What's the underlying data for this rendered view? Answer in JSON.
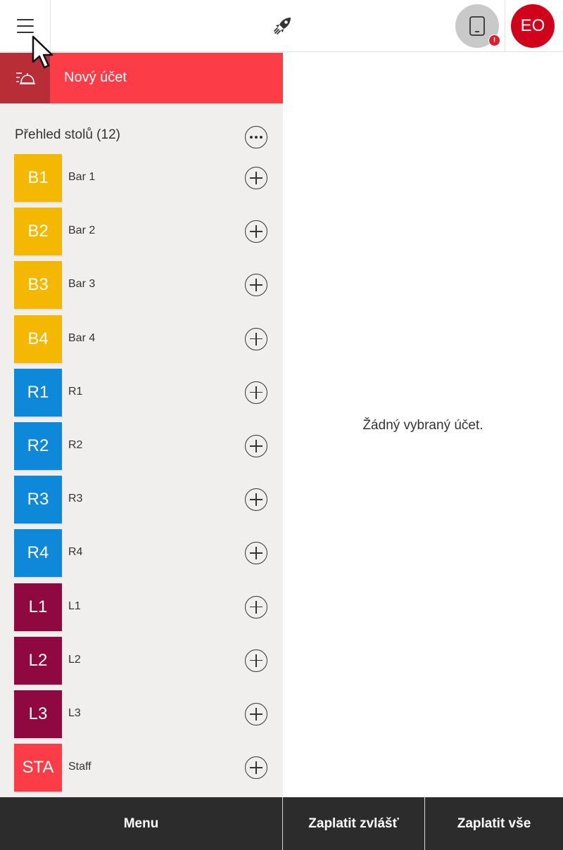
{
  "header": {
    "menu_icon": "hamburger-icon",
    "center_icon": "rocket-icon",
    "device_icon": "tablet-icon",
    "device_alert": "!",
    "avatar_initials": "EO"
  },
  "sidebar": {
    "new_bill_label": "Nový účet",
    "new_bill_icon": "service-bell-icon",
    "overview_title": "Přehled stolů (12)",
    "more_icon": "more-horizontal-icon",
    "tables": [
      {
        "code": "B1",
        "name": "Bar 1",
        "color": "#f5b800"
      },
      {
        "code": "B2",
        "name": "Bar 2",
        "color": "#f5b800"
      },
      {
        "code": "B3",
        "name": "Bar 3",
        "color": "#f5b800"
      },
      {
        "code": "B4",
        "name": "Bar 4",
        "color": "#f5b800"
      },
      {
        "code": "R1",
        "name": "R1",
        "color": "#0e88d8"
      },
      {
        "code": "R2",
        "name": "R2",
        "color": "#0e88d8"
      },
      {
        "code": "R3",
        "name": "R3",
        "color": "#0e88d8"
      },
      {
        "code": "R4",
        "name": "R4",
        "color": "#0e88d8"
      },
      {
        "code": "L1",
        "name": "L1",
        "color": "#8f0840"
      },
      {
        "code": "L2",
        "name": "L2",
        "color": "#8f0840"
      },
      {
        "code": "L3",
        "name": "L3",
        "color": "#8f0840"
      },
      {
        "code": "STA",
        "name": "Staff",
        "color": "#fc3d47"
      }
    ]
  },
  "main": {
    "empty_message": "Žádný vybraný účet."
  },
  "footer": {
    "menu_label": "Menu",
    "pay_separately_label": "Zaplatit zvlášť",
    "pay_all_label": "Zaplatit vše"
  },
  "colors": {
    "accent": "#fc3d47",
    "accent_dark": "#b82d36",
    "avatar": "#d0021b",
    "footer": "#2c2c2c"
  }
}
